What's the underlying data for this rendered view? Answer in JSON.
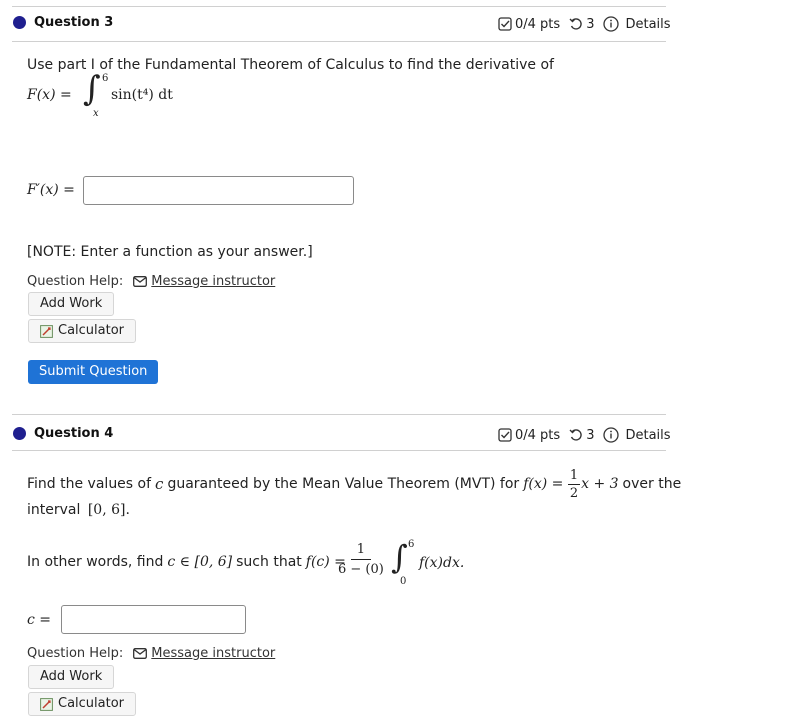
{
  "questions": [
    {
      "title": "Question 3",
      "points": "0/4 pts",
      "attempts": "3",
      "details_label": "Details",
      "prompt": "Use part I of the Fundamental Theorem of Calculus to find the derivative of",
      "function_lhs": "F(x) = ",
      "integral_upper": "6",
      "integral_lower": "x",
      "integrand": "sin(t⁴) dt",
      "answer_label": "F′(x) =",
      "answer_value": "",
      "note": "[NOTE: Enter a function as your answer.]",
      "help_label": "Question Help:",
      "message_label": "Message instructor",
      "add_work_label": "Add Work",
      "calculator_label": "Calculator",
      "submit_label": "Submit Question"
    },
    {
      "title": "Question 4",
      "points": "0/4 pts",
      "attempts": "3",
      "details_label": "Details",
      "prompt_part1": "Find the values of",
      "var_c": "c",
      "prompt_part2": "guaranteed by the Mean Value Theorem (MVT) for",
      "f_of_x": "f(x) = ",
      "frac_num": "1",
      "frac_den": "2",
      "f_rest": "x + 3",
      "over_the": "over the",
      "interval_label": "interval",
      "interval": "[0, 6].",
      "other_words": "In other words, find",
      "c_in": "c ∈ [0, 6]",
      "such_that": "such that",
      "f_of_c": "f(c) = ",
      "mvt_num": "1",
      "mvt_den": "6 − (0)",
      "int_upper": "6",
      "int_lower": "0",
      "mvt_integrand": "f(x)dx.",
      "answer_label": "c =",
      "answer_value": "",
      "help_label": "Question Help:",
      "message_label": "Message instructor",
      "add_work_label": "Add Work",
      "calculator_label": "Calculator"
    }
  ]
}
